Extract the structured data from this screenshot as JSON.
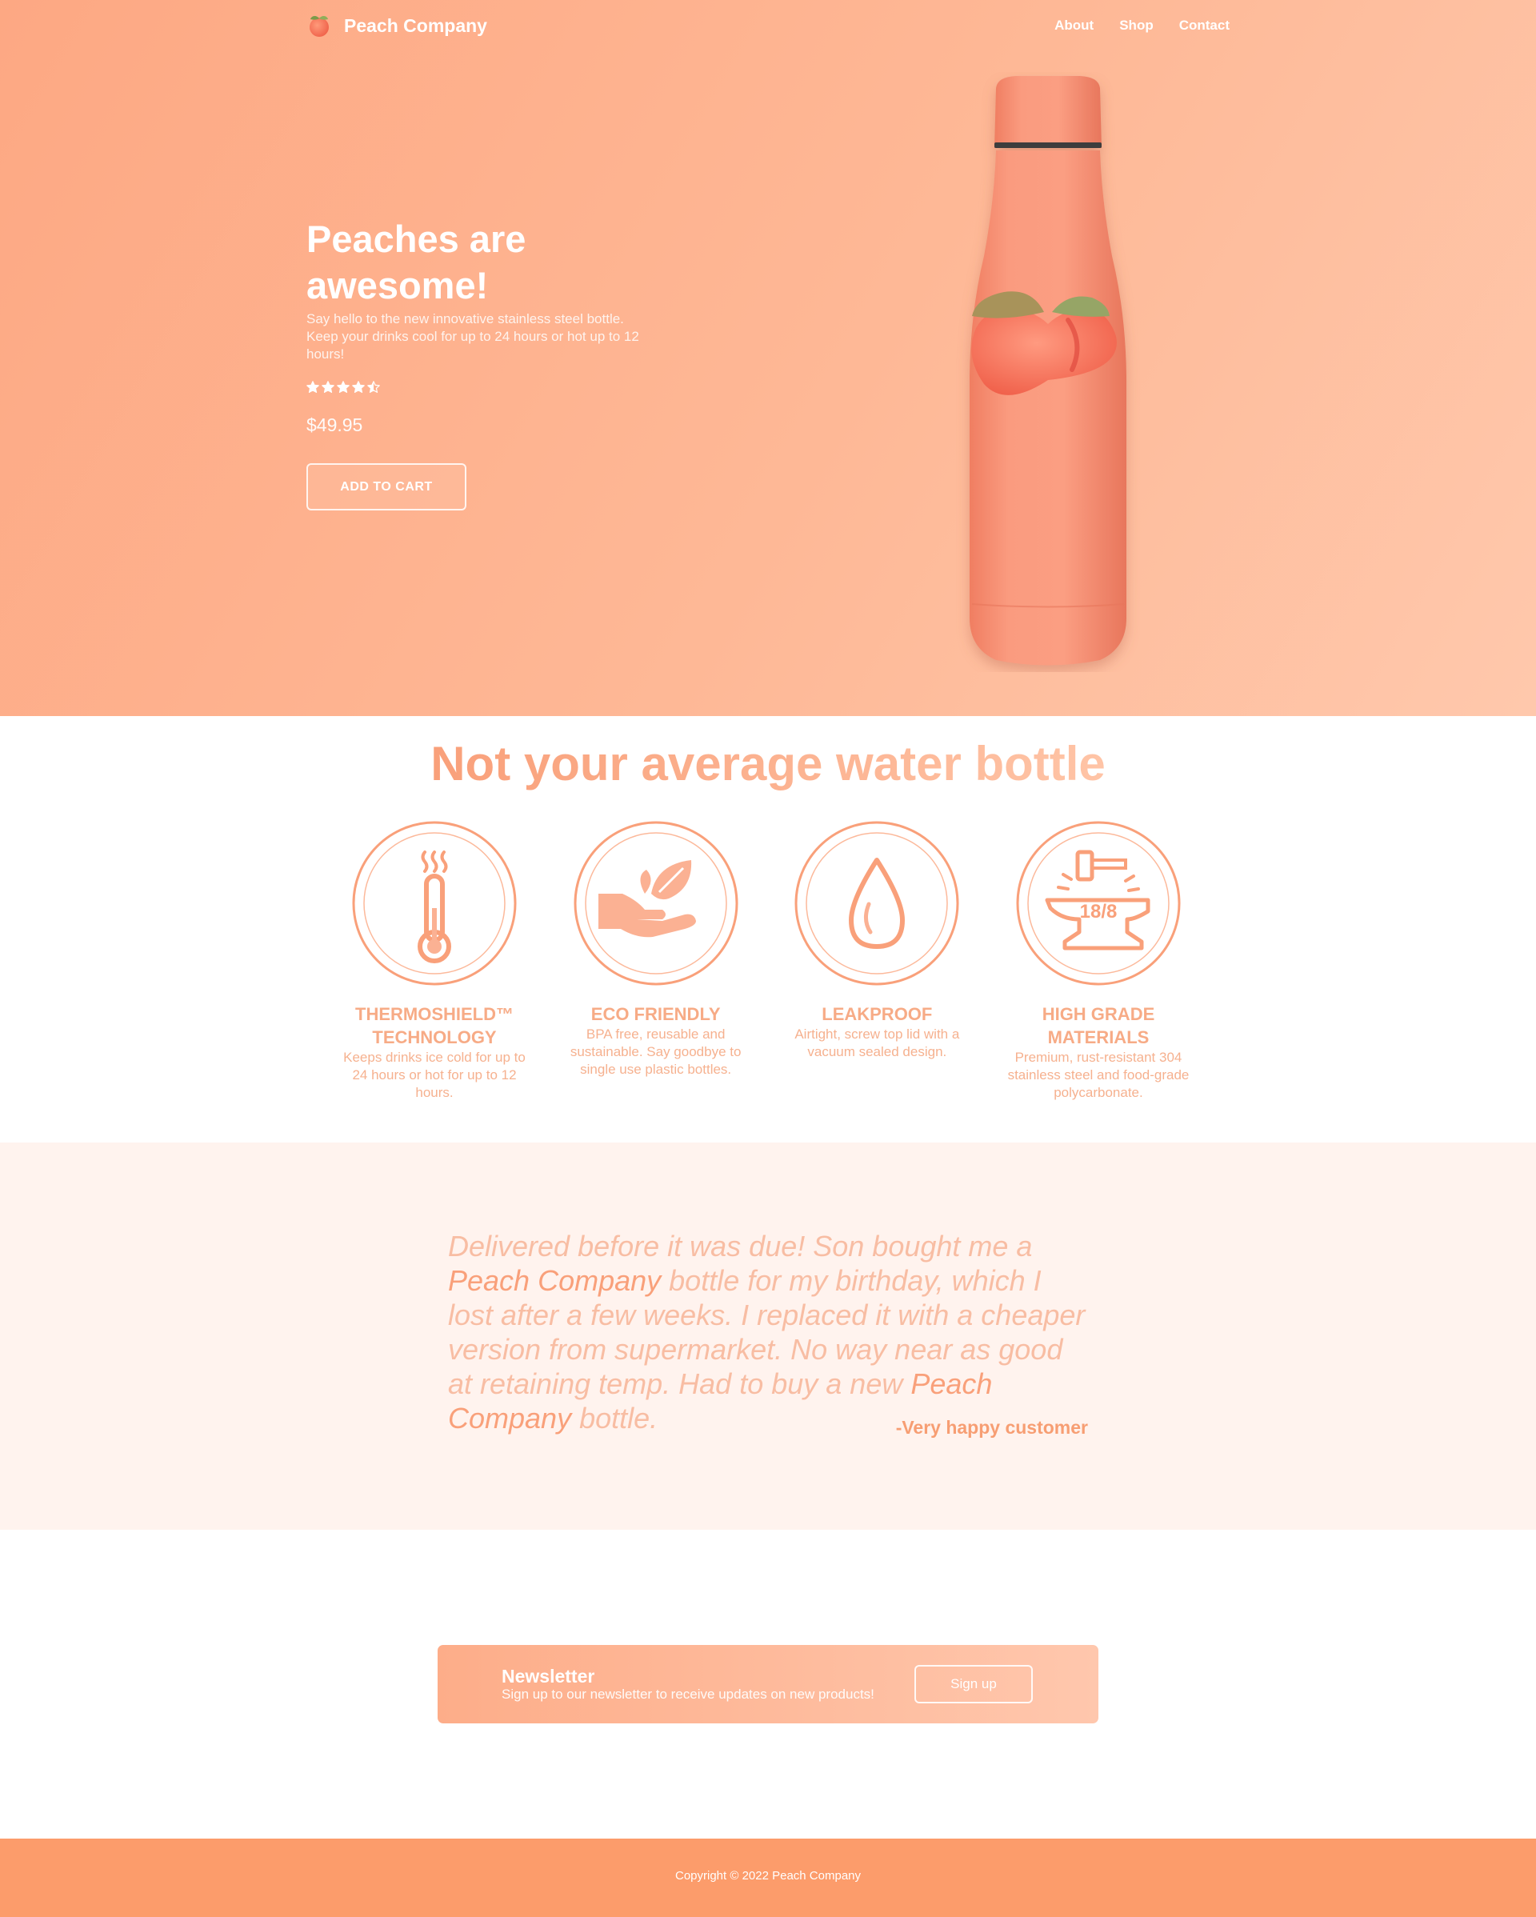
{
  "nav": {
    "brand": "Peach Company",
    "links": [
      "About",
      "Shop",
      "Contact"
    ]
  },
  "hero": {
    "title": "Peaches are awesome!",
    "description": "Say hello to the new innovative stainless steel bottle. Keep your drinks cool for up to 24 hours or hot up to 12 hours!",
    "rating": 4.5,
    "price": "$49.95",
    "cta_label": "ADD TO CART"
  },
  "features": {
    "title": "Not your average water bottle",
    "items": [
      {
        "title": "THERMOSHIELD™ TECHNOLOGY",
        "description": "Keeps drinks ice cold for up to 24 hours or hot for up to 12 hours.",
        "icon": "thermometer-icon"
      },
      {
        "title": "ECO FRIENDLY",
        "description": "BPA free, reusable and sustainable. Say goodbye to single use plastic bottles.",
        "icon": "leaf-hand-icon"
      },
      {
        "title": "LEAKPROOF",
        "description": "Airtight, screw top lid with a vacuum sealed design.",
        "icon": "water-drop-icon"
      },
      {
        "title": "HIGH GRADE MATERIALS",
        "description": "Premium, rust-resistant 304 stainless steel and food-grade polycarbonate.",
        "icon": "anvil-icon",
        "badge": "18/8"
      }
    ]
  },
  "testimonial": {
    "parts": [
      "Delivered before it was due! Son bought me a ",
      "Peach Company",
      " bottle for my birthday, which I lost after a few weeks. I replaced it with a cheaper version from supermarket. No way near as good at retaining temp. Had to buy a new ",
      "Peach Company",
      " bottle."
    ],
    "author": "-Very happy customer"
  },
  "newsletter": {
    "title": "Newsletter",
    "description": "Sign up to our newsletter to receive updates on new products!",
    "button_label": "Sign up"
  },
  "footer": {
    "copyright": "Copyright © 2022 Peach Company"
  },
  "colors": {
    "peach": "#fda883",
    "accent": "#f9a07a",
    "footer": "#fc9c6b",
    "testimonial_bg": "#fff3ee"
  }
}
